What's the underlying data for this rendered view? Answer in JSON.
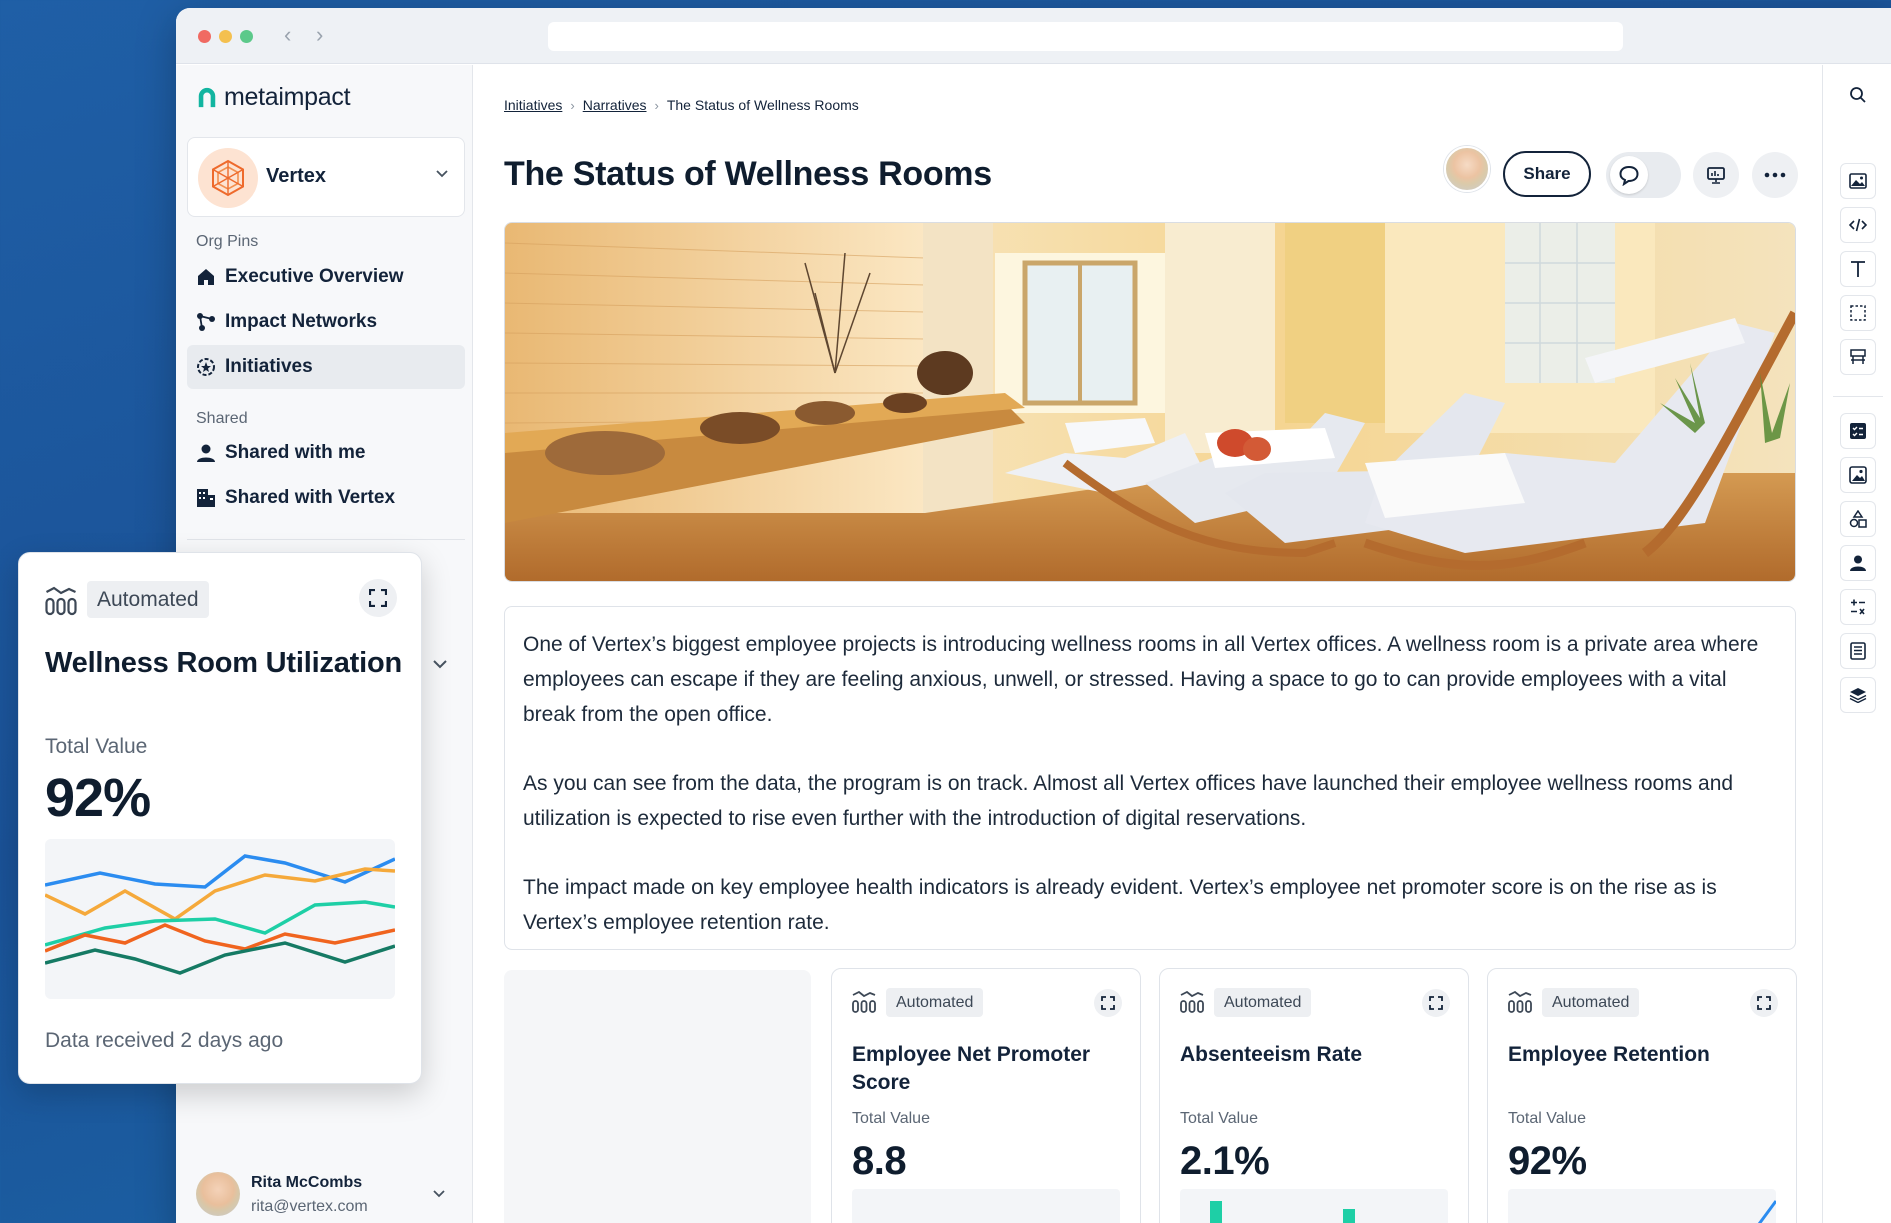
{
  "app": {
    "logo_text": "metaimpact",
    "nav_back": "‹",
    "nav_forward": "›"
  },
  "sidebar": {
    "org_name": "Vertex",
    "org_pins_label": "Org Pins",
    "pins": [
      {
        "label": "Executive Overview",
        "icon": "home-icon"
      },
      {
        "label": "Impact Networks",
        "icon": "network-icon"
      },
      {
        "label": "Initiatives",
        "icon": "initiatives-icon",
        "active": true
      }
    ],
    "shared_label": "Shared",
    "shared": [
      {
        "label": "Shared with me",
        "icon": "user-icon"
      },
      {
        "label": "Shared with Vertex",
        "icon": "building-icon"
      }
    ],
    "user": {
      "name": "Rita McCombs",
      "email": "rita@vertex.com"
    }
  },
  "breadcrumb": {
    "items": [
      "Initiatives",
      "Narratives"
    ],
    "current": "The Status of Wellness Rooms",
    "separator": "›"
  },
  "page": {
    "title": "The Status of Wellness Rooms",
    "share_label": "Share"
  },
  "narrative": [
    "One of Vertex’s biggest employee projects is introducing wellness rooms in all Vertex offices. A wellness room is a private area where employees can escape if they are feeling anxious, unwell, or stressed. Having a space to go to can provide employees with a vital break from the open office.",
    "As you can see from the data, the program is on track. Almost all Vertex offices have launched their employee wellness rooms and utilization is expected to rise even further with the introduction of digital reservations.",
    "The impact made on key employee health indicators is already evident. Vertex’s employee net promoter score is on the rise as is Vertex’s employee retention rate."
  ],
  "metric_cards": [
    {
      "tag": "Automated",
      "title": "Employee Net Promoter Score",
      "sub": "Total Value",
      "value": "8.8"
    },
    {
      "tag": "Automated",
      "title": "Absenteeism Rate",
      "sub": "Total Value",
      "value": "2.1%"
    },
    {
      "tag": "Automated",
      "title": "Employee Retention",
      "sub": "Total Value",
      "value": "92%"
    }
  ],
  "floating_card": {
    "tag": "Automated",
    "title": "Wellness Room Utilization",
    "sub": "Total Value",
    "value": "92%",
    "footer": "Data received 2 days ago",
    "series_colors": [
      "#2b8cf0",
      "#f5a93b",
      "#1ecfa6",
      "#f0641f",
      "#157a64"
    ]
  },
  "colors": {
    "accent_teal": "#12b5a0",
    "text_dark": "#13233a",
    "background_blue": "#1a5196"
  },
  "rail_icons": [
    "search-icon",
    "image-icon",
    "code-icon",
    "text-icon",
    "frame-icon",
    "layout-icon",
    "checklist-icon",
    "picture-icon",
    "shapes-icon",
    "person-icon",
    "calculator-icon",
    "document-icon",
    "layers-icon"
  ]
}
